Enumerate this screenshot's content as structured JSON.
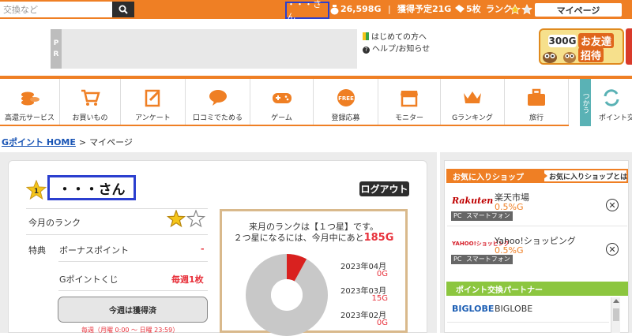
{
  "header": {
    "search": {
      "placeholder": "交換など"
    },
    "user_name": "・・・さん",
    "points": "26,598G",
    "separator": "|",
    "expected_label": "獲得予定21G",
    "tickets": "5枚",
    "rank_label": "ランク",
    "mypage_label": "マイページ",
    "accent_color": "#ef7f24"
  },
  "promo": {
    "pr_label": [
      "P",
      "R"
    ],
    "beginner_link": "はじめての方へ",
    "help_link": "ヘルプ/お知らせ",
    "friend_points": "300G",
    "friend_line1": "お友達",
    "friend_line2": "招待"
  },
  "categories": [
    {
      "label": "高還元サービス",
      "icon": "coins-icon"
    },
    {
      "label": "お買いもの",
      "icon": "cart-icon"
    },
    {
      "label": "アンケート",
      "icon": "survey-icon"
    },
    {
      "label": "口コミでためる",
      "icon": "chat-bubble-icon"
    },
    {
      "label": "ゲーム",
      "icon": "gamepad-icon"
    },
    {
      "label": "登録応募",
      "icon": "free-badge-icon"
    },
    {
      "label": "モニター",
      "icon": "store-icon"
    },
    {
      "label": "Gランキング",
      "icon": "crown-icon"
    },
    {
      "label": "旅行",
      "icon": "suitcase-icon"
    }
  ],
  "side_tab": {
    "label": "つかう",
    "exchange_label": "ポイント交"
  },
  "breadcrumb": {
    "home": "Gポイント HOME",
    "sep": ">",
    "current": "マイページ"
  },
  "profile": {
    "rank_badge": "1",
    "user_name": "・・・さん",
    "logout": "ログアウト",
    "this_month_rank_label": "今月のランク",
    "rank_stars_filled": 1,
    "rank_stars_total": 2,
    "benefits_label": "特典",
    "bonus_label": "ボーナスポイント",
    "bonus_value": "-",
    "lottery_label": "Gポイントくじ",
    "lottery_value": "毎週1枚",
    "weekly_button": "今週は獲得済",
    "weekly_note": "毎週（月曜 0:00 ～ 日曜 23:59）"
  },
  "rank_box": {
    "msg1": "来月のランクは【１つ星】です。",
    "msg2_prefix": "２つ星になるには、今月中にあと",
    "msg2_need": "185G",
    "progress_fraction": 0.08,
    "months": [
      {
        "label": "2023年04月",
        "value": "0G"
      },
      {
        "label": "2023年03月",
        "value": "15G"
      },
      {
        "label": "2023年02月",
        "value": "0G"
      }
    ]
  },
  "favorites": {
    "title": "お気に入りショップ",
    "help": "お気に入りショップとは",
    "shops": [
      {
        "logo": "Rakuten",
        "name": "楽天市場",
        "rate": "0.5%G",
        "tags": [
          "PC",
          "スマートフォン"
        ]
      },
      {
        "logo": "YAHOO!ショッピング",
        "name": "Yahoo!ショッピング",
        "rate": "0.5%G",
        "tags": [
          "PC",
          "スマートフォン"
        ]
      }
    ]
  },
  "partners": {
    "title": "ポイント交換パートナー",
    "items": [
      {
        "logo": "BIGLOBE",
        "name": "BIGLOBE"
      }
    ]
  }
}
